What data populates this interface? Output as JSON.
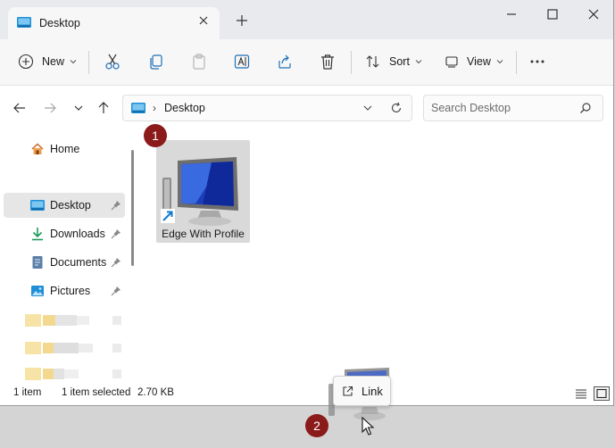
{
  "tab": {
    "title": "Desktop"
  },
  "toolbar": {
    "new_label": "New",
    "sort_label": "Sort",
    "view_label": "View"
  },
  "address": {
    "path_label": "Desktop",
    "separator": "›"
  },
  "search": {
    "placeholder": "Search Desktop"
  },
  "nav": {
    "items": [
      {
        "label": "Home"
      },
      {
        "label": "Desktop"
      },
      {
        "label": "Downloads"
      },
      {
        "label": "Documents"
      },
      {
        "label": "Pictures"
      }
    ]
  },
  "content": {
    "file_name": "Edge With Profile"
  },
  "status": {
    "item_count": "1 item",
    "selection": "1 item selected",
    "size": "2.70 KB"
  },
  "badges": {
    "first": "1",
    "second": "2"
  },
  "drag": {
    "tooltip_label": "Link"
  },
  "colors": {
    "badge": "#8b1a1a",
    "accent": "#0067c0"
  }
}
